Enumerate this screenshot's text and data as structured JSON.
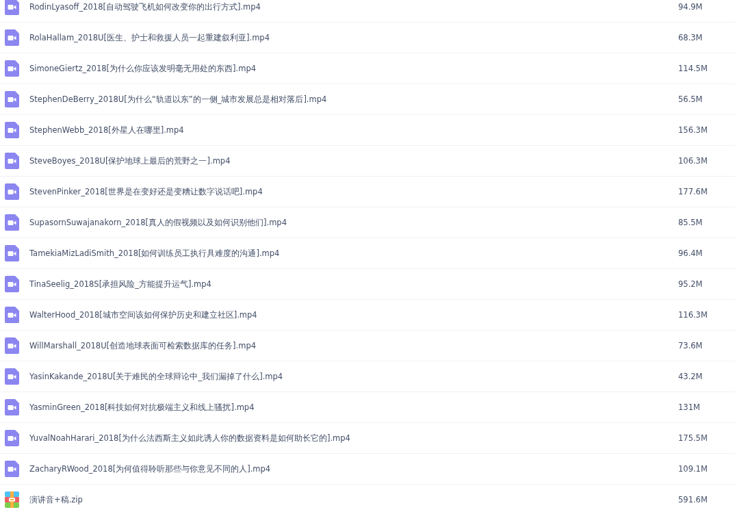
{
  "files": [
    {
      "kind": "video",
      "name": "RodinLyasoff_2018[自动驾驶飞机如何改变你的出行方式].mp4",
      "size": "94.9M"
    },
    {
      "kind": "video",
      "name": "RolaHallam_2018U[医生、护士和救援人员一起重建叙利亚].mp4",
      "size": "68.3M"
    },
    {
      "kind": "video",
      "name": "SimoneGiertz_2018[为什么你应该发明毫无用处的东西].mp4",
      "size": "114.5M"
    },
    {
      "kind": "video",
      "name": "StephenDeBerry_2018U[为什么“轨道以东”的一侧_城市发展总是相对落后].mp4",
      "size": "56.5M"
    },
    {
      "kind": "video",
      "name": "StephenWebb_2018[外星人在哪里].mp4",
      "size": "156.3M"
    },
    {
      "kind": "video",
      "name": "SteveBoyes_2018U[保护地球上最后的荒野之一].mp4",
      "size": "106.3M"
    },
    {
      "kind": "video",
      "name": "StevenPinker_2018[世界是在变好还是变糟让数字说话吧].mp4",
      "size": "177.6M"
    },
    {
      "kind": "video",
      "name": "SupasornSuwajanakorn_2018[真人的假视频以及如何识别他们].mp4",
      "size": "85.5M"
    },
    {
      "kind": "video",
      "name": "TamekiaMizLadiSmith_2018[如何训练员工执行具难度的沟通].mp4",
      "size": "96.4M"
    },
    {
      "kind": "video",
      "name": "TinaSeelig_2018S[承担风险_方能提升运气].mp4",
      "size": "95.2M"
    },
    {
      "kind": "video",
      "name": "WalterHood_2018[城市空间该如何保护历史和建立社区].mp4",
      "size": "116.3M"
    },
    {
      "kind": "video",
      "name": "WillMarshall_2018U[创造地球表面可检索数据库的任务].mp4",
      "size": "73.6M"
    },
    {
      "kind": "video",
      "name": "YasinKakande_2018U[关于难民的全球辩论中_我们漏掉了什么].mp4",
      "size": "43.2M"
    },
    {
      "kind": "video",
      "name": "YasminGreen_2018[科技如何对抗极端主义和线上骚扰].mp4",
      "size": "131M"
    },
    {
      "kind": "video",
      "name": "YuvalNoahHarari_2018[为什么法西斯主义如此诱人你的数据资料是如何助长它的].mp4",
      "size": "175.5M"
    },
    {
      "kind": "video",
      "name": "ZacharyRWood_2018[为何值得聆听那些与你意见不同的人].mp4",
      "size": "109.1M"
    },
    {
      "kind": "archive",
      "name": "演讲音+稿.zip",
      "size": "591.6M"
    }
  ]
}
